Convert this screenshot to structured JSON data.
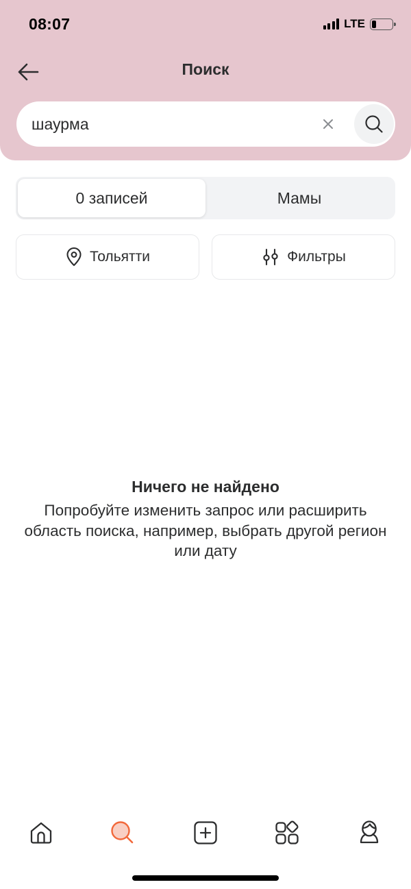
{
  "status_bar": {
    "time": "08:07",
    "network": "LTE",
    "battery_level": 0.2
  },
  "nav": {
    "title": "Поиск",
    "back_icon": "arrow-left-icon"
  },
  "search": {
    "value": "шаурма",
    "placeholder": "",
    "clear_icon": "close-icon",
    "search_icon": "search-icon"
  },
  "segments": {
    "items": [
      {
        "label": "0 записей",
        "active": true
      },
      {
        "label": "Мамы",
        "active": false
      }
    ]
  },
  "chips": {
    "city": {
      "label": "Тольятти",
      "icon": "location-pin-icon"
    },
    "filters": {
      "label": "Фильтры",
      "icon": "sliders-icon"
    }
  },
  "empty_state": {
    "title": "Ничего не найдено",
    "text": "Попробуйте изменить запрос или расширить область поиска, например, выбрать другой регион или дату"
  },
  "tab_bar": {
    "active_tab": "search",
    "tabs": [
      {
        "id": "home",
        "icon": "home-icon"
      },
      {
        "id": "search",
        "icon": "search-icon"
      },
      {
        "id": "create",
        "icon": "add-post-icon"
      },
      {
        "id": "services",
        "icon": "services-grid-icon"
      },
      {
        "id": "profile",
        "icon": "profile-avatar-icon"
      }
    ]
  },
  "colors": {
    "header_bg": "#e6c6ce",
    "accent": "#f2683a",
    "accent_fill": "#f9cfc3",
    "text": "#2c2d2e",
    "icon_gray": "#5f6368"
  }
}
